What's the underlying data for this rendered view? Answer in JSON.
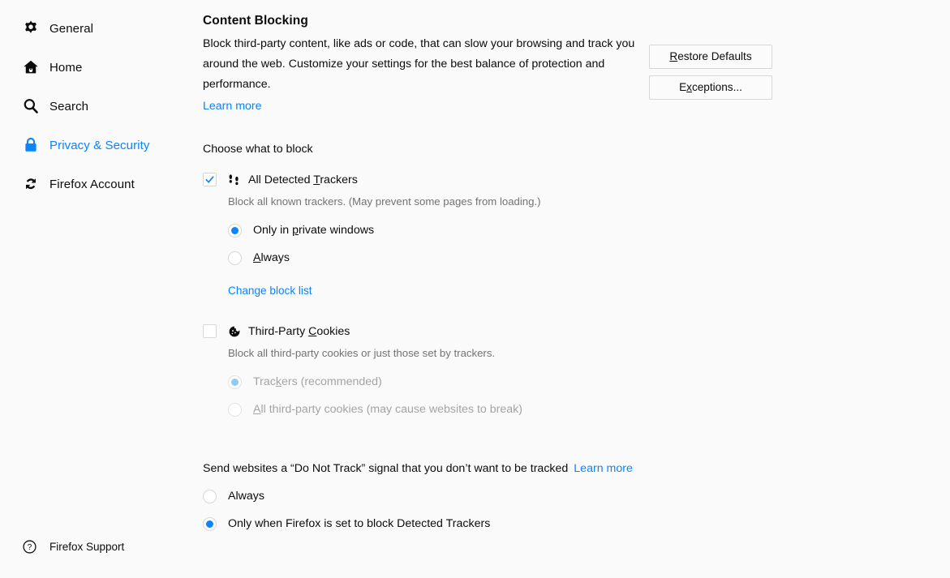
{
  "sidebar": {
    "items": [
      {
        "label": "General",
        "icon": "gear-icon",
        "selected": false
      },
      {
        "label": "Home",
        "icon": "home-icon",
        "selected": false
      },
      {
        "label": "Search",
        "icon": "search-icon",
        "selected": false
      },
      {
        "label": "Privacy & Security",
        "icon": "lock-icon",
        "selected": true
      },
      {
        "label": "Firefox Account",
        "icon": "sync-icon",
        "selected": false
      }
    ],
    "support": {
      "label": "Firefox Support",
      "icon": "help-circle-icon"
    }
  },
  "main": {
    "title": "Content Blocking",
    "description": "Block third-party content, like ads or code, that can slow your browsing and track you around the web. Customize your settings for the best balance of protection and performance.",
    "learn_more": "Learn more",
    "choose_label": "Choose what to block",
    "buttons": {
      "restore_defaults": {
        "pre": "",
        "accesskey": "R",
        "post": "estore Defaults"
      },
      "exceptions": {
        "pre": "E",
        "accesskey": "x",
        "post": "ceptions..."
      }
    },
    "trackers": {
      "icon": "footprints-icon",
      "checked": true,
      "label_pre": "All Detected ",
      "label_accesskey": "T",
      "label_post": "rackers",
      "description": "Block all known trackers. (May prevent some pages from loading.)",
      "options": [
        {
          "pre": "Only in ",
          "accesskey": "p",
          "post": "rivate windows",
          "selected": true
        },
        {
          "pre": "",
          "accesskey": "A",
          "post": "lways",
          "selected": false
        }
      ],
      "change_block_list": "Change block list"
    },
    "cookies": {
      "icon": "cookie-icon",
      "checked": false,
      "disabled": true,
      "label_pre": "Third-Party ",
      "label_accesskey": "C",
      "label_post": "ookies",
      "description": "Block all third-party cookies or just those set by trackers.",
      "options": [
        {
          "pre": "Trac",
          "accesskey": "k",
          "post": "ers (recommended)",
          "selected": true
        },
        {
          "pre": "",
          "accesskey": "A",
          "post": "ll third-party cookies (may cause websites to break)",
          "selected": false
        }
      ]
    },
    "do_not_track": {
      "heading": "Send websites a “Do Not Track” signal that you don’t want to be tracked",
      "learn_more": "Learn more",
      "options": [
        {
          "label": "Always",
          "selected": false
        },
        {
          "label": "Only when Firefox is set to block Detected Trackers",
          "selected": true
        }
      ]
    }
  },
  "colors": {
    "accent": "#0a84ff",
    "background": "#fafafa",
    "text": "#0c0c0d",
    "muted_text": "#737373",
    "disabled_text": "#a4a4a6"
  }
}
